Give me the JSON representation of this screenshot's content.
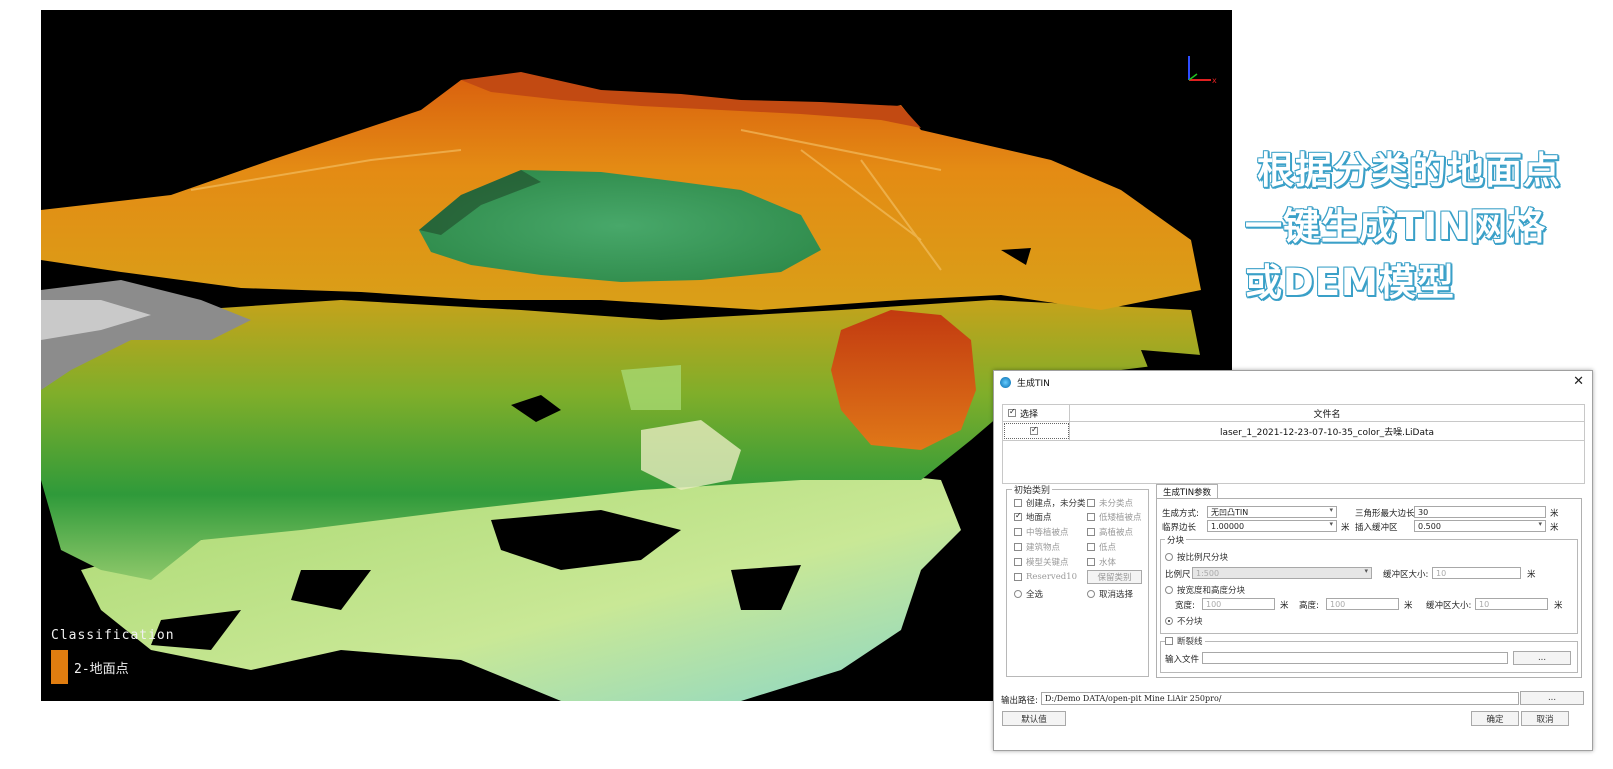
{
  "viewer": {
    "legend_title": "Classification",
    "legend_label": "2-地面点",
    "legend_color": "#e07d10",
    "axis_x_label": "x"
  },
  "headline": {
    "line1": "根据分类的地面点",
    "line2": "一键生成TIN网格",
    "line3": "或DEM模型",
    "text_color": "#ffffff",
    "outline_color": "#3aa0c8"
  },
  "dialog": {
    "title": "生成TIN",
    "close_glyph": "✕",
    "table": {
      "col_select": "选择",
      "col_filename": "文件名",
      "rows": [
        {
          "checked": true,
          "filename": "laser_1_2021-12-23-07-10-35_color_去噪.LiData"
        }
      ]
    },
    "classes": {
      "legend": "初始类别",
      "items": [
        {
          "label": "创建点，未分类",
          "checked": false,
          "enabled": true
        },
        {
          "label": "未分类点",
          "checked": false,
          "enabled": false
        },
        {
          "label": "地面点",
          "checked": true,
          "enabled": true
        },
        {
          "label": "低矮植被点",
          "checked": false,
          "enabled": false
        },
        {
          "label": "中等植被点",
          "checked": false,
          "enabled": false
        },
        {
          "label": "高植被点",
          "checked": false,
          "enabled": false
        },
        {
          "label": "建筑物点",
          "checked": false,
          "enabled": false
        },
        {
          "label": "低点",
          "checked": false,
          "enabled": false
        },
        {
          "label": "模型关键点",
          "checked": false,
          "enabled": false
        },
        {
          "label": "水体",
          "checked": false,
          "enabled": false
        },
        {
          "label": "Reserved10",
          "checked": false,
          "enabled": false
        }
      ],
      "keep_class_button": "保留类别",
      "select_all": "全选",
      "deselect": "取消选择"
    },
    "tin_params": {
      "tab_label": "生成TIN参数",
      "method_label": "生成方式:",
      "method_value": "无凹凸TIN",
      "max_edge_label": "三角形最大边长",
      "max_edge_value": "30",
      "boundary_label": "临界边长",
      "boundary_value": "1.00000",
      "buffer_label": "插入缓冲区",
      "buffer_value": "0.500",
      "unit": "米",
      "block_legend": "分块",
      "by_scale_label": "按比例尺分块",
      "scale_label": "比例尺",
      "scale_value": "1:500",
      "buffer_size_label": "缓冲区大小:",
      "buffer_size_value": "10",
      "by_wh_label": "按宽度和高度分块",
      "width_label": "宽度:",
      "width_value": "100",
      "height_label": "高度:",
      "height_value": "100",
      "buffer_size_value2": "10",
      "no_block_label": "不分块",
      "breakline_label": "断裂线",
      "input_file_label": "输入文件",
      "browse_label": "..."
    },
    "output": {
      "path_label": "输出路径:",
      "path_value": "D:/Demo DATA/open-pit Mine LiAir 250pro/",
      "browse_label": "..."
    },
    "buttons": {
      "default": "默认值",
      "ok": "确定",
      "cancel": "取消"
    }
  }
}
